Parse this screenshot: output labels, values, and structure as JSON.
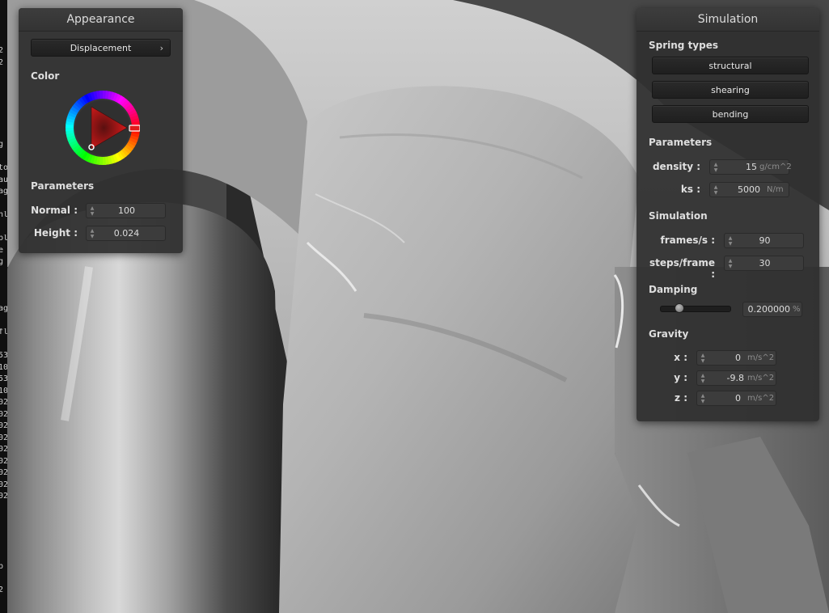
{
  "appearance": {
    "title": "Appearance",
    "shader_button": "Displacement",
    "chevron_icon": "chevron-right-icon",
    "color_section": "Color",
    "color_wheel_icon": "color-wheel-icon",
    "selected_color": "#e01b1b",
    "parameters_section": "Parameters",
    "normal_label": "Normal :",
    "normal_value": "100",
    "height_label": "Height :",
    "height_value": "0.024"
  },
  "simulation": {
    "title": "Simulation",
    "spring_types_section": "Spring types",
    "structural_button": "structural",
    "shearing_button": "shearing",
    "bending_button": "bending",
    "parameters_section": "Parameters",
    "density_label": "density :",
    "density_value": "15",
    "density_unit": "g/cm^2",
    "ks_label": "ks :",
    "ks_value": "5000",
    "ks_unit": "N/m",
    "simulation_section": "Simulation",
    "fps_label": "frames/s :",
    "fps_value": "90",
    "steps_label": "steps/frame :",
    "steps_value": "30",
    "damping_section": "Damping",
    "damping_value": "0.200000",
    "damping_unit": "%",
    "damping_slider_fraction": 0.2,
    "gravity_section": "Gravity",
    "x_label": "x :",
    "x_value": "0",
    "x_unit": "m/s^2",
    "y_label": "y :",
    "y_value": "-9.8",
    "y_unit": "m/s^2",
    "z_label": "z :",
    "z_value": "0",
    "z_unit": "m/s^2"
  },
  "terminal_lines": [
    "2",
    "2",
    "",
    "",
    "",
    "",
    "",
    "",
    "g",
    "",
    "to",
    "au",
    "ag",
    "",
    "nl",
    "",
    "pl",
    "e",
    "g",
    "",
    "",
    "",
    "ag",
    "",
    "fl",
    "",
    "53",
    "10",
    "53",
    "10",
    "02",
    "02",
    "02",
    "02",
    "02",
    "02",
    "02",
    "02",
    "02",
    "",
    "",
    "",
    "",
    "",
    "p",
    "",
    "2"
  ]
}
